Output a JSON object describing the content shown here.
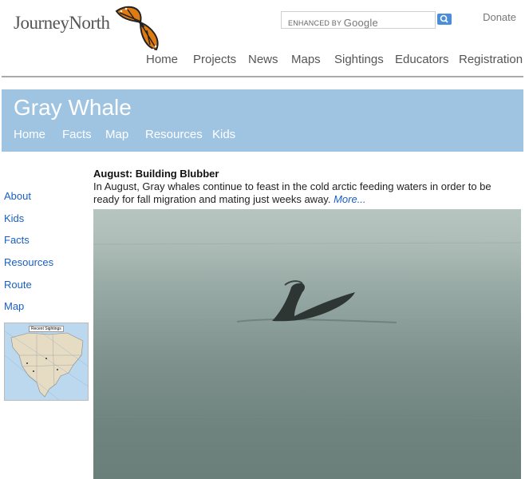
{
  "header": {
    "logo_text": "JourneyNorth",
    "search_enhanced": "ENHANCED BY",
    "search_google": "Google",
    "donate": "Donate",
    "nav": [
      "Home",
      "Projects",
      "News",
      "Maps",
      "Sightings",
      "Educators",
      "Registration"
    ]
  },
  "banner": {
    "title": "Gray Whale",
    "nav": [
      "Home",
      "Facts",
      "Map",
      "Resources",
      "Kids"
    ]
  },
  "sidebar": {
    "items": [
      "About",
      "Kids",
      "Facts",
      "Resources",
      "Route",
      "Map"
    ],
    "map_caption": "Recent Sightings"
  },
  "article": {
    "title": "August: Building Blubber",
    "body": "In August, Gray whales continue to feast in the cold arctic feeding waters in order to be ready for fall migration and mating just weeks away.",
    "more": "More..."
  },
  "colors": {
    "banner": "#9fc4e2",
    "link": "#1a5fbf"
  }
}
